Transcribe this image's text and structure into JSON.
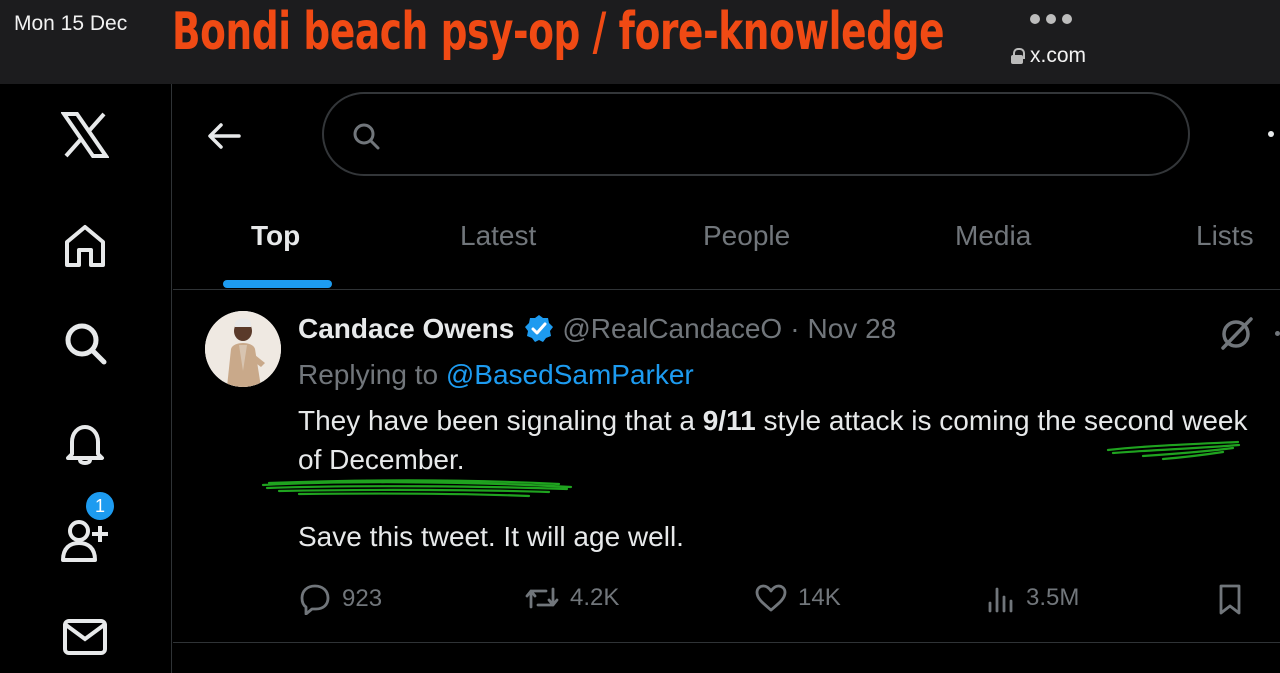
{
  "status": {
    "date": "Mon 15 Dec",
    "url": "x.com"
  },
  "overlay": {
    "title": "Bondi beach psy-op / fore-knowledge",
    "color": "#f04a14"
  },
  "sidebar": {
    "items": [
      {
        "icon": "x-logo-icon"
      },
      {
        "icon": "home-icon"
      },
      {
        "icon": "search-icon"
      },
      {
        "icon": "bell-icon",
        "badge": "1"
      },
      {
        "icon": "follow-icon"
      },
      {
        "icon": "mail-icon"
      }
    ]
  },
  "search": {
    "placeholder": ""
  },
  "tabs": [
    {
      "label": "Top",
      "active": true
    },
    {
      "label": "Latest"
    },
    {
      "label": "People"
    },
    {
      "label": "Media"
    },
    {
      "label": "Lists"
    }
  ],
  "tweet": {
    "name": "Candace Owens",
    "handle": "@RealCandaceO",
    "separator": "·",
    "date": "Nov 28",
    "replying_prefix": "Replying to ",
    "replying_to": "@BasedSamParker",
    "text_before": "They have been signaling that a ",
    "text_bold": "9/11",
    "text_after": " style attack is coming the second week of December.",
    "text_second": "Save this tweet. It will age well.",
    "replies": "923",
    "reposts": "4.2K",
    "likes": "14K",
    "views": "3.5M"
  },
  "colors": {
    "accent": "#1d9bf0",
    "muted": "#71767b",
    "text": "#e7e9ea",
    "highlight": "#1fa31f"
  }
}
